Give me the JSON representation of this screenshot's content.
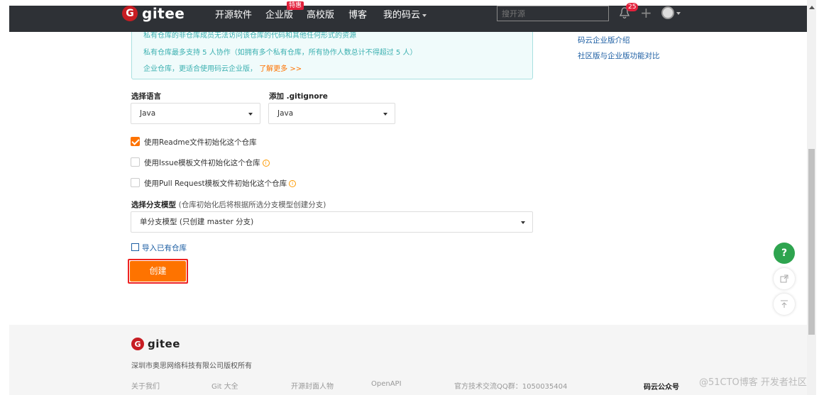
{
  "nav": {
    "logo_text": "gitee",
    "links": [
      "开源软件",
      "企业版",
      "高校版",
      "博客",
      "我的码云"
    ],
    "new_badge": "特惠",
    "search_placeholder": "搜开源",
    "notification_count": "25"
  },
  "info": {
    "line1": "私有仓库的非仓库成员无法访问该仓库的代码和其他任何形式的资源",
    "line2": "私有仓库最多支持 5 人协作（如拥有多个私有仓库，所有协作人数总计不得超过 5 人）",
    "line3": "企业仓库，更适合使用码云企业版，",
    "line3_link": "了解更多 >>"
  },
  "side_links": [
    "码云企业版介绍",
    "社区版与企业版功能对比"
  ],
  "form": {
    "language_label": "选择语言",
    "language_value": "Java",
    "gitignore_label": "添加 .gitignore",
    "gitignore_value": "Java",
    "checkboxes": [
      {
        "label": "使用Readme文件初始化这个仓库",
        "checked": true
      },
      {
        "label": "使用Issue模板文件初始化这个仓库",
        "checked": false
      },
      {
        "label": "使用Pull Request模板文件初始化这个仓库",
        "checked": false
      }
    ],
    "branch_label": "选择分支模型",
    "branch_hint": "(仓库初始化后将根据所选分支模型创建分支)",
    "branch_value": "单分支模型 (只创建 master 分支)",
    "import_label": "导入已有仓库",
    "create_label": "创建"
  },
  "float": {
    "help": "?"
  },
  "footer": {
    "logo_text": "gitee",
    "copyright": "深圳市奥思网络科技有限公司版权所有",
    "links": [
      "关于我们",
      "Git 大全",
      "开源封面人物",
      "OpenAPI",
      "官方技术交流QQ群：1050035404"
    ],
    "qr_label": "码云公众号",
    "watermark": "@51CTO博客 开发者社区"
  },
  "colors": {
    "accent": "#fe7300",
    "nav_bg": "#2e3136",
    "link": "#1c5ea3",
    "info_text": "#3bb0b0"
  }
}
